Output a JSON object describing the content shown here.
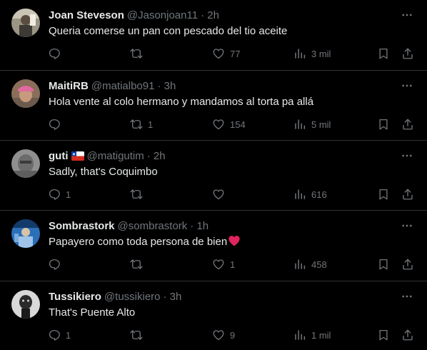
{
  "tweets": [
    {
      "name": "Joan Steveson",
      "handle": "@Jasonjoan11",
      "time": "· 2h",
      "text": "Queria comerse un pan con pescado del tio aceite",
      "replies": "",
      "retweets": "",
      "likes": "77",
      "views": "3 mil"
    },
    {
      "name": "MaitiRB",
      "handle": "@matialbo91",
      "time": "· 3h",
      "text": "Hola vente al colo hermano y mandamos al torta pa allá",
      "replies": "",
      "retweets": "1",
      "likes": "154",
      "views": "5 mil"
    },
    {
      "name": "guti",
      "handle": "@matigutim",
      "time": "· 2h",
      "text": "Sadly, that's Coquimbo",
      "replies": "1",
      "retweets": "",
      "likes": "",
      "views": "616"
    },
    {
      "name": "Sombrastork",
      "handle": "@sombrastork",
      "time": "· 1h",
      "text": "Papayero como toda persona de bien",
      "replies": "",
      "retweets": "",
      "likes": "1",
      "views": "458"
    },
    {
      "name": "Tussikiero",
      "handle": "@tussikiero",
      "time": "· 3h",
      "text": "That's Puente Alto",
      "replies": "1",
      "retweets": "",
      "likes": "9",
      "views": "1 mil"
    }
  ],
  "icons": {
    "reply": "reply-icon",
    "retweet": "retweet-icon",
    "like": "heart-icon",
    "views": "views-icon",
    "bookmark": "bookmark-icon",
    "share": "share-icon",
    "more": "more-icon"
  },
  "colors": {
    "background": "#000000",
    "text": "#e7e9ea",
    "secondary": "#71767b",
    "divider": "#2f3336",
    "heart_emoji": "#e0245e"
  }
}
